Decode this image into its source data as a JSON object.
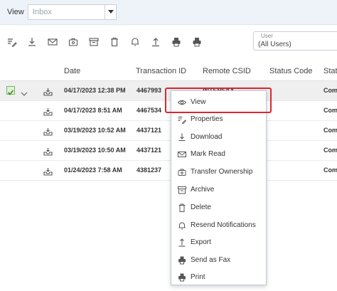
{
  "filter": {
    "label": "View",
    "value": "Inbox"
  },
  "toolbar": {
    "icons": [
      "properties-icon",
      "download-icon",
      "mail-icon",
      "transfer-icon",
      "archive-icon",
      "delete-icon",
      "notification-icon",
      "export-icon",
      "fax-icon",
      "print-icon"
    ]
  },
  "user_filter": {
    "label": "User",
    "value": "(All Users)"
  },
  "grid": {
    "columns": [
      "Date",
      "Transaction ID",
      "Remote CSID",
      "Status Code",
      "Statu"
    ],
    "rows": [
      {
        "date": "04/17/2023 12:38 PM",
        "transaction_id": "4467993",
        "remote_csid": "INTERFAX",
        "status": "Com",
        "selected": true
      },
      {
        "date": "04/17/2023 8:51 AM",
        "transaction_id": "4467534",
        "remote_csid": "",
        "status": "Com",
        "selected": false
      },
      {
        "date": "03/19/2023 10:52 AM",
        "transaction_id": "4437121",
        "remote_csid": "",
        "status": "Com",
        "selected": false
      },
      {
        "date": "03/19/2023 10:50 AM",
        "transaction_id": "4437121",
        "remote_csid": "",
        "status": "Com",
        "selected": false
      },
      {
        "date": "01/24/2023 7:58 AM",
        "transaction_id": "4381237",
        "remote_csid": "",
        "status": "Com",
        "selected": false
      }
    ]
  },
  "context_menu": {
    "items": [
      {
        "label": "View",
        "icon": "eye-icon"
      },
      {
        "label": "Properties",
        "icon": "properties-icon"
      },
      {
        "label": "Download",
        "icon": "download-icon"
      },
      {
        "label": "Mark Read",
        "icon": "mail-icon"
      },
      {
        "label": "Transfer Ownership",
        "icon": "transfer-icon"
      },
      {
        "label": "Archive",
        "icon": "archive-icon"
      },
      {
        "label": "Delete",
        "icon": "delete-icon"
      },
      {
        "label": "Resend Notifications",
        "icon": "notification-icon"
      },
      {
        "label": "Export",
        "icon": "export-icon"
      },
      {
        "label": "Send as Fax",
        "icon": "fax-icon"
      },
      {
        "label": "Print",
        "icon": "print-icon"
      }
    ]
  },
  "colors": {
    "highlight": "#e0242b",
    "topbar": "#eef3f9",
    "checkbox": "#79b45e"
  }
}
